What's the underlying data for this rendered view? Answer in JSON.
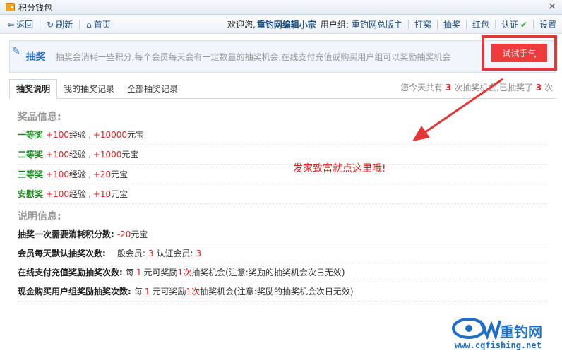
{
  "window": {
    "title": "积分钱包"
  },
  "nav": {
    "back": "返回",
    "refresh": "刷新",
    "home": "首页",
    "welcome": "欢迎您,",
    "username": "重钓网编辑小宗",
    "group_label": "用户组:",
    "group_value": "重钓网总版主",
    "links": [
      "打窝",
      "抽奖",
      "红包",
      "认证",
      "设置"
    ]
  },
  "banner": {
    "label": "抽奖",
    "description": "抽奖会消耗一些积分,每个会员每天会有一定数量的抽奖机会,在线支付充值或购买用户组可以奖励抽奖机会",
    "button": "试试手气"
  },
  "tabs": {
    "items": [
      "抽奖说明",
      "我的抽奖记录",
      "全部抽奖记录"
    ],
    "summary_prefix": "您今天共有",
    "total": "3",
    "summary_mid": "次抽奖机会,已抽奖了",
    "used": "3",
    "summary_suffix": "次"
  },
  "prizes": {
    "title": "奖品信息:",
    "items": [
      {
        "name": "一等奖",
        "exp": "+100",
        "exp_unit": "经验",
        "sep": ",",
        "coin": "+10000",
        "coin_unit": "元宝"
      },
      {
        "name": "二等奖",
        "exp": "+100",
        "exp_unit": "经验",
        "sep": ",",
        "coin": "+1000",
        "coin_unit": "元宝"
      },
      {
        "name": "三等奖",
        "exp": "+100",
        "exp_unit": "经验",
        "sep": ",",
        "coin": "+20",
        "coin_unit": "元宝"
      },
      {
        "name": "安慰奖",
        "exp": "+100",
        "exp_unit": "经验",
        "sep": ",",
        "coin": "+10",
        "coin_unit": "元宝"
      }
    ]
  },
  "info": {
    "title": "说明信息:",
    "cost_key": "抽奖一次需要消耗积分数:",
    "cost_value": "-20",
    "cost_unit": "元宝",
    "default_key": "会员每天默认抽奖次数:",
    "member_label": "一般会员:",
    "member_value": "3",
    "verified_label": "认证会员:",
    "verified_value": "3",
    "online_key": "在线支付充值奖励抽奖次数:",
    "online_a": "每",
    "online_n1": "1",
    "online_b": "元可奖励",
    "online_n2": "1次",
    "online_c": "抽奖机会(注意:奖励的抽奖机会次日无效)",
    "cash_key": "现金购买用户组奖励抽奖次数:",
    "cash_a": "每",
    "cash_n1": "1",
    "cash_b": "元可奖励",
    "cash_n2": "1次",
    "cash_c": "抽奖机会(注意:奖励的抽奖机会次日无效)"
  },
  "annotation": "发家致富就点这里哦!",
  "watermark": {
    "brand": "重钓网",
    "url": "www.cqfishing.net"
  }
}
